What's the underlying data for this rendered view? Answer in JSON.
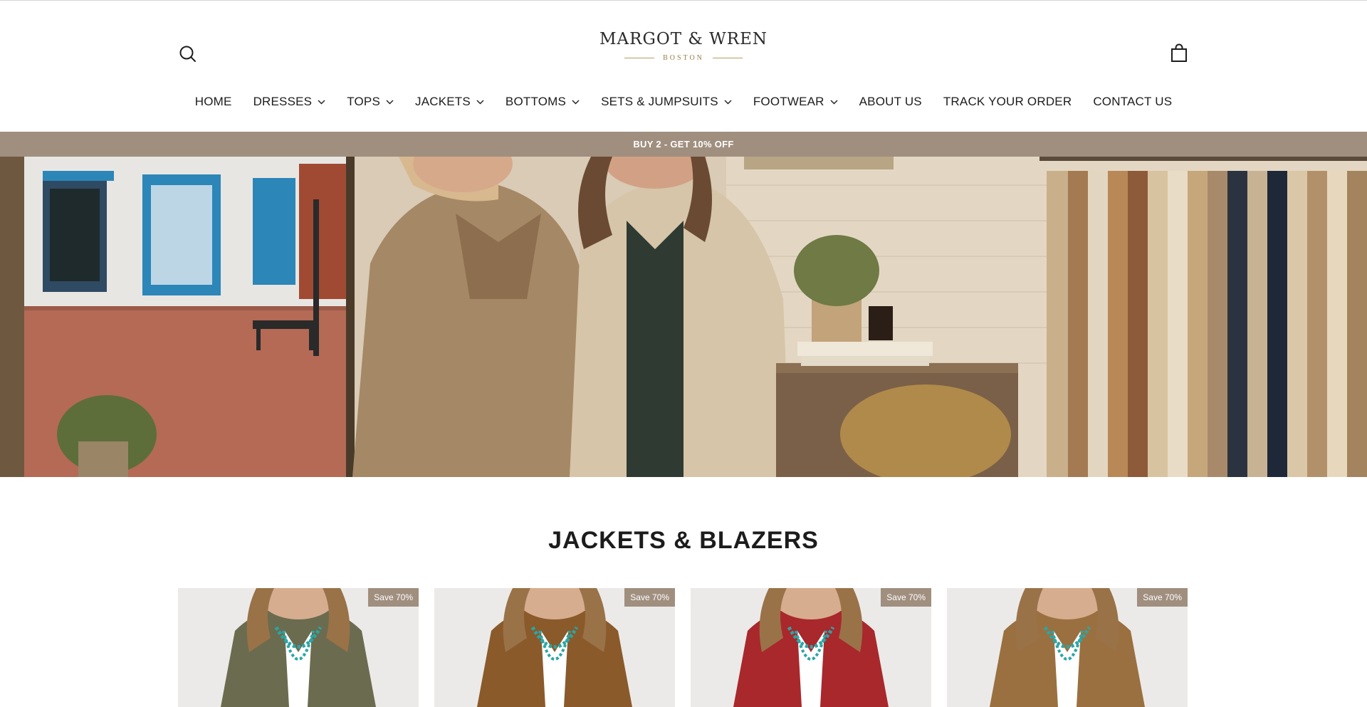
{
  "header": {
    "logo_name": "MARGOT & WREN",
    "logo_city": "BOSTON",
    "search_icon": "search-icon",
    "cart_icon": "shopping-bag-icon"
  },
  "nav": {
    "items": [
      {
        "label": "HOME",
        "has_dropdown": false
      },
      {
        "label": "DRESSES",
        "has_dropdown": true
      },
      {
        "label": "TOPS",
        "has_dropdown": true
      },
      {
        "label": "JACKETS",
        "has_dropdown": true
      },
      {
        "label": "BOTTOMS",
        "has_dropdown": true
      },
      {
        "label": "SETS & JUMPSUITS",
        "has_dropdown": true
      },
      {
        "label": "FOOTWEAR",
        "has_dropdown": true
      },
      {
        "label": "ABOUT US",
        "has_dropdown": false
      },
      {
        "label": "TRACK YOUR ORDER",
        "has_dropdown": false
      },
      {
        "label": "CONTACT US",
        "has_dropdown": false
      }
    ]
  },
  "announcement": {
    "text": "BUY 2 - GET 10% OFF",
    "bg_color": "#a08f7f"
  },
  "section": {
    "title": "JACKETS & BLAZERS"
  },
  "products": [
    {
      "badge": "Save 70%",
      "color": "#6b6b4f"
    },
    {
      "badge": "Save 70%",
      "color": "#8a5a2b"
    },
    {
      "badge": "Save 70%",
      "color": "#a8282c"
    },
    {
      "badge": "Save 70%",
      "color": "#9a7040"
    }
  ]
}
